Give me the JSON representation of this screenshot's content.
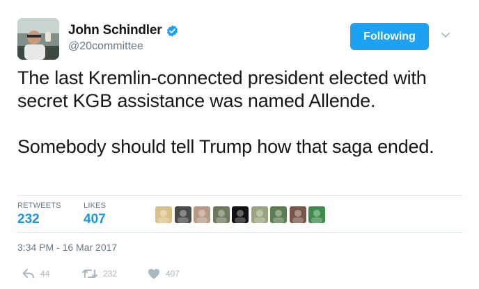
{
  "author": {
    "display_name": "John Schindler",
    "handle": "@20committee",
    "verified": true,
    "avatar_icon": "user-avatar-photo"
  },
  "follow_button": {
    "label": "Following",
    "color": "#1da1f2"
  },
  "tweet": {
    "paragraphs": [
      "The last Kremlin-connected president elected with secret KGB assistance was named Allende.",
      "Somebody should tell Trump how that saga ended."
    ]
  },
  "stats": {
    "retweets_label": "RETWEETS",
    "retweets_value": "232",
    "likes_label": "LIKES",
    "likes_value": "407",
    "accent_color": "#1b95e0"
  },
  "likers": [
    {
      "icon": "liker-avatar-1",
      "color": "#d9c28a"
    },
    {
      "icon": "liker-avatar-2",
      "color": "#4a4a4a"
    },
    {
      "icon": "liker-avatar-3",
      "color": "#b79a86"
    },
    {
      "icon": "liker-avatar-4",
      "color": "#6f7a5c"
    },
    {
      "icon": "liker-avatar-5",
      "color": "#111111"
    },
    {
      "icon": "liker-avatar-6",
      "color": "#9aa57f"
    },
    {
      "icon": "liker-avatar-7",
      "color": "#5d7d53"
    },
    {
      "icon": "liker-avatar-8",
      "color": "#7a5648"
    },
    {
      "icon": "liker-avatar-9",
      "color": "#3f8a4d"
    }
  ],
  "timestamp": "3:34 PM - 16 Mar 2017",
  "actions": {
    "reply_count": "44",
    "retweet_count": "232",
    "like_count": "407",
    "icon_color": "#aab8c2"
  }
}
